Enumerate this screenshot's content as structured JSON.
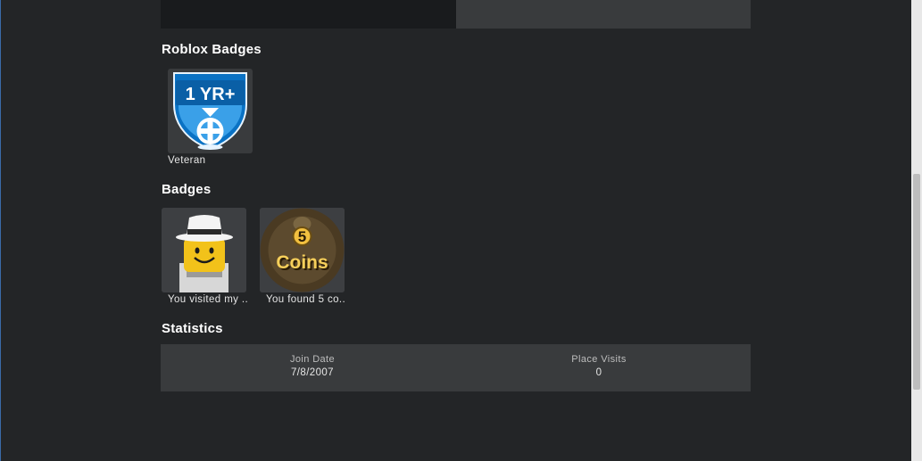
{
  "sections": {
    "roblox_badges_title": "Roblox Badges",
    "badges_title": "Badges",
    "statistics_title": "Statistics"
  },
  "roblox_badges": [
    {
      "label": "Veteran",
      "icon_text": "1 YR+",
      "icon": "veteran-badge-icon"
    }
  ],
  "badges": [
    {
      "label": "You visited my ...",
      "icon": "noob-fedora-badge-icon"
    },
    {
      "label": "You found 5 co...",
      "icon": "five-coins-badge-icon",
      "icon_number": "5",
      "icon_word": "Coins"
    }
  ],
  "statistics": [
    {
      "label": "Join Date",
      "value": "7/8/2007"
    },
    {
      "label": "Place Visits",
      "value": "0"
    }
  ],
  "colors": {
    "background": "#232527",
    "card": "#393b3d",
    "badge_blue": "#0a72c4"
  }
}
